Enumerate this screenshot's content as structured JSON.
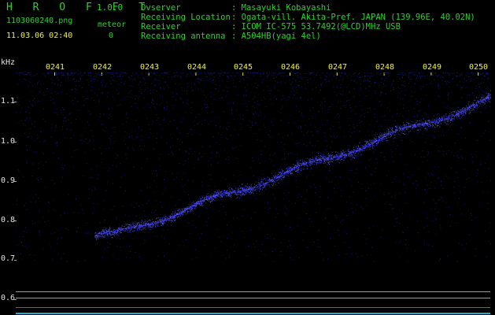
{
  "app": {
    "name": "H R O F F T",
    "version": "1.0.0",
    "filename": "1103060240.png",
    "datetime": "11.03.06 02:40",
    "counter_label": "meteor",
    "counter_value": "0"
  },
  "info": {
    "rows": [
      {
        "label": "Ovserver",
        "value": ": Masayuki Kobayashi"
      },
      {
        "label": "Receiving Location",
        "value": ": Ogata-vill. Akita-Pref. JAPAN (139.96E, 40.02N)"
      },
      {
        "label": "Receiver",
        "value": ": ICOM IC-575 53.7492(@LCD)MHz USB"
      },
      {
        "label": "Receiving antenna",
        "value": ": A504HB(yagi 4el)"
      }
    ]
  },
  "spectrogram": {
    "y_unit": "kHz",
    "y_ticks": [
      "1.1",
      "1.0",
      "0.9",
      "0.8",
      "0.7",
      "0.6"
    ],
    "time_ticks": [
      "0241",
      "0242",
      "0243",
      "0244",
      "0245",
      "0246",
      "0247",
      "0248",
      "0249",
      "0250"
    ],
    "colors": {
      "header": "#2fd02f",
      "time": "#f2f23a",
      "signal": "#3a3aff",
      "noise": "#1a1a8c"
    }
  }
}
